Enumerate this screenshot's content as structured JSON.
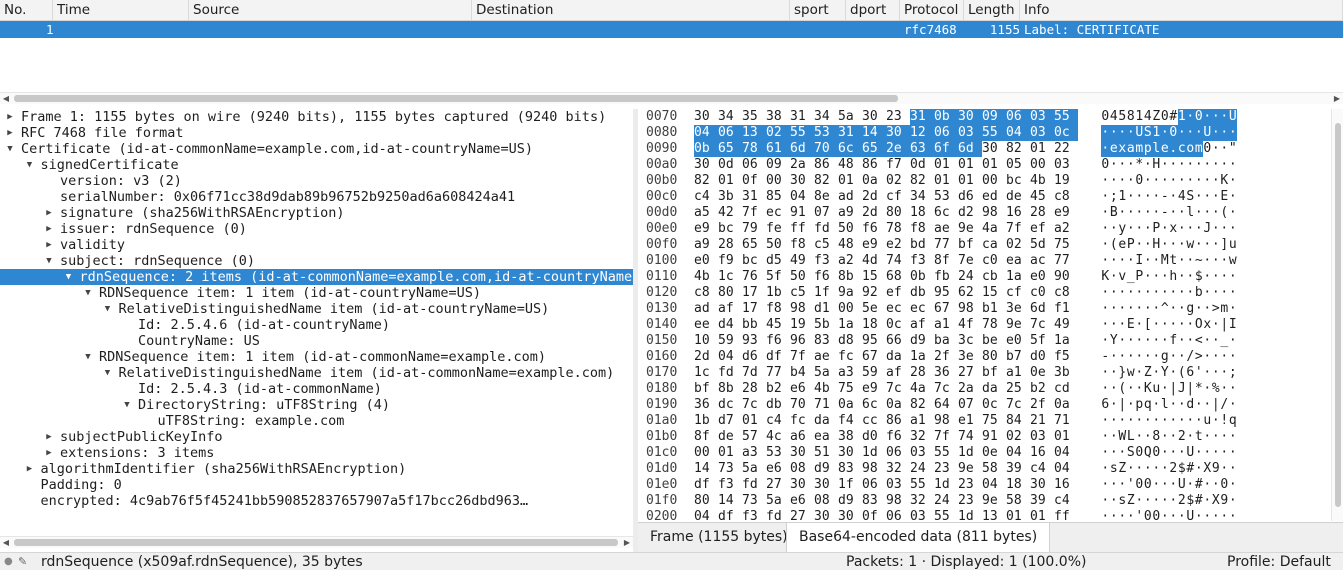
{
  "packet_list": {
    "columns": [
      "No.",
      "Time",
      "Source",
      "Destination",
      "sport",
      "dport",
      "Protocol",
      "Length",
      "Info"
    ],
    "rows": [
      {
        "no": "1",
        "time": "",
        "source": "",
        "destination": "",
        "sport": "",
        "dport": "",
        "protocol": "rfc7468",
        "length": "1155",
        "info": "Label: CERTIFICATE"
      }
    ]
  },
  "tree": [
    {
      "depth": 0,
      "arrow": "collapsed",
      "text": "Frame 1: 1155 bytes on wire (9240 bits), 1155 bytes captured (9240 bits)"
    },
    {
      "depth": 0,
      "arrow": "collapsed",
      "text": "RFC 7468 file format"
    },
    {
      "depth": 0,
      "arrow": "expanded",
      "text": "Certificate (id-at-commonName=example.com,id-at-countryName=US)"
    },
    {
      "depth": 1,
      "arrow": "expanded",
      "text": "signedCertificate"
    },
    {
      "depth": 2,
      "arrow": "none",
      "text": "version: v3 (2)"
    },
    {
      "depth": 2,
      "arrow": "none",
      "text": "serialNumber: 0x06f71cc38d9dab89b96752b9250ad6a608424a41"
    },
    {
      "depth": 2,
      "arrow": "collapsed",
      "text": "signature (sha256WithRSAEncryption)"
    },
    {
      "depth": 2,
      "arrow": "collapsed",
      "text": "issuer: rdnSequence (0)"
    },
    {
      "depth": 2,
      "arrow": "collapsed",
      "text": "validity"
    },
    {
      "depth": 2,
      "arrow": "expanded",
      "text": "subject: rdnSequence (0)"
    },
    {
      "depth": 3,
      "arrow": "expanded",
      "text": "rdnSequence: 2 items (id-at-commonName=example.com,id-at-countryName",
      "selected": true
    },
    {
      "depth": 4,
      "arrow": "expanded",
      "text": "RDNSequence item: 1 item (id-at-countryName=US)"
    },
    {
      "depth": 5,
      "arrow": "expanded",
      "text": "RelativeDistinguishedName item (id-at-countryName=US)"
    },
    {
      "depth": 6,
      "arrow": "none",
      "text": "Id: 2.5.4.6 (id-at-countryName)"
    },
    {
      "depth": 6,
      "arrow": "none",
      "text": "CountryName: US"
    },
    {
      "depth": 4,
      "arrow": "expanded",
      "text": "RDNSequence item: 1 item (id-at-commonName=example.com)"
    },
    {
      "depth": 5,
      "arrow": "expanded",
      "text": "RelativeDistinguishedName item (id-at-commonName=example.com)"
    },
    {
      "depth": 6,
      "arrow": "none",
      "text": "Id: 2.5.4.3 (id-at-commonName)"
    },
    {
      "depth": 6,
      "arrow": "expanded",
      "text": "DirectoryString: uTF8String (4)"
    },
    {
      "depth": 7,
      "arrow": "none",
      "text": "uTF8String: example.com"
    },
    {
      "depth": 2,
      "arrow": "collapsed",
      "text": "subjectPublicKeyInfo"
    },
    {
      "depth": 2,
      "arrow": "collapsed",
      "text": "extensions: 3 items"
    },
    {
      "depth": 1,
      "arrow": "collapsed",
      "text": "algorithmIdentifier (sha256WithRSAEncryption)"
    },
    {
      "depth": 1,
      "arrow": "none",
      "text": "Padding: 0"
    },
    {
      "depth": 1,
      "arrow": "none",
      "text": "encrypted: 4c9ab76f5f45241bb590852837657907a5f17bcc26dbd963…"
    }
  ],
  "hex": [
    {
      "off": "0070",
      "bytes": "30 34 35 38 31 34 5a 30 23 31 0b 30 09 06 03 55",
      "ascii": "045814Z0#1·0···U",
      "hl_start": 9,
      "hl_end": 16
    },
    {
      "off": "0080",
      "bytes": "04 06 13 02 55 53 31 14 30 12 06 03 55 04 03 0c",
      "ascii": "····US1·0···U···",
      "hl_start": 0,
      "hl_end": 16
    },
    {
      "off": "0090",
      "bytes": "0b 65 78 61 6d 70 6c 65 2e 63 6f 6d 30 82 01 22",
      "ascii": "·example.com0··\"",
      "hl_start": 0,
      "hl_end": 12
    },
    {
      "off": "00a0",
      "bytes": "30 0d 06 09 2a 86 48 86 f7 0d 01 01 01 05 00 03",
      "ascii": "0···*·H·········"
    },
    {
      "off": "00b0",
      "bytes": "82 01 0f 00 30 82 01 0a 02 82 01 01 00 bc 4b 19",
      "ascii": "····0·········K·"
    },
    {
      "off": "00c0",
      "bytes": "c4 3b 31 85 04 8e ad 2d cf 34 53 d6 ed de 45 c8",
      "ascii": "·;1····-·4S···E·"
    },
    {
      "off": "00d0",
      "bytes": "a5 42 7f ec 91 07 a9 2d 80 18 6c d2 98 16 28 e9",
      "ascii": "·B·····-··l···(·"
    },
    {
      "off": "00e0",
      "bytes": "e9 bc 79 fe ff fd 50 f6 78 f8 ae 9e 4a 7f ef a2",
      "ascii": "··y···P·x···J···"
    },
    {
      "off": "00f0",
      "bytes": "a9 28 65 50 f8 c5 48 e9 e2 bd 77 bf ca 02 5d 75",
      "ascii": "·(eP··H···w···]u"
    },
    {
      "off": "0100",
      "bytes": "e0 f9 bc d5 49 f3 a2 4d 74 f3 8f 7e c0 ea ac 77",
      "ascii": "····I··Mt··~···w"
    },
    {
      "off": "0110",
      "bytes": "4b 1c 76 5f 50 f6 8b 15 68 0b fb 24 cb 1a e0 90",
      "ascii": "K·v_P···h··$····"
    },
    {
      "off": "0120",
      "bytes": "c8 80 17 1b c5 1f 9a 92 ef db 95 62 15 cf c0 c8",
      "ascii": "···········b····"
    },
    {
      "off": "0130",
      "bytes": "ad af 17 f8 98 d1 00 5e ec ec 67 98 b1 3e 6d f1",
      "ascii": "·······^··g··>m·"
    },
    {
      "off": "0140",
      "bytes": "ee d4 bb 45 19 5b 1a 18 0c af a1 4f 78 9e 7c 49",
      "ascii": "···E·[·····Ox·|I"
    },
    {
      "off": "0150",
      "bytes": "10 59 93 f6 96 83 d8 95 66 d9 ba 3c be e0 5f 1a",
      "ascii": "·Y······f··<··_·"
    },
    {
      "off": "0160",
      "bytes": "2d 04 d6 df 7f ae fc 67 da 1a 2f 3e 80 b7 d0 f5",
      "ascii": "-······g··/>····"
    },
    {
      "off": "0170",
      "bytes": "1c fd 7d 77 b4 5a a3 59 af 28 36 27 bf a1 0e 3b",
      "ascii": "··}w·Z·Y·(6'···;"
    },
    {
      "off": "0180",
      "bytes": "bf 8b 28 b2 e6 4b 75 e9 7c 4a 7c 2a da 25 b2 cd",
      "ascii": "··(··Ku·|J|*·%··"
    },
    {
      "off": "0190",
      "bytes": "36 dc 7c db 70 71 0a 6c 0a 82 64 07 0c 7c 2f 0a",
      "ascii": "6·|·pq·l··d··|/·"
    },
    {
      "off": "01a0",
      "bytes": "1b d7 01 c4 fc da f4 cc 86 a1 98 e1 75 84 21 71",
      "ascii": "············u·!q"
    },
    {
      "off": "01b0",
      "bytes": "8f de 57 4c a6 ea 38 d0 f6 32 7f 74 91 02 03 01",
      "ascii": "··WL··8··2·t····"
    },
    {
      "off": "01c0",
      "bytes": "00 01 a3 53 30 51 30 1d 06 03 55 1d 0e 04 16 04",
      "ascii": "···S0Q0···U·····"
    },
    {
      "off": "01d0",
      "bytes": "14 73 5a e6 08 d9 83 98 32 24 23 9e 58 39 c4 04",
      "ascii": "·sZ·····2$#·X9··"
    },
    {
      "off": "01e0",
      "bytes": "df f3 fd 27 30 30 1f 06 03 55 1d 23 04 18 30 16",
      "ascii": "···'00···U·#··0·"
    },
    {
      "off": "01f0",
      "bytes": "80 14 73 5a e6 08 d9 83 98 32 24 23 9e 58 39 c4",
      "ascii": "··sZ·····2$#·X9·"
    },
    {
      "off": "0200",
      "bytes": "04 df f3 fd 27 30 30 0f 06 03 55 1d 13 01 01 ff",
      "ascii": "····'00···U·····"
    }
  ],
  "byte_tabs": [
    {
      "label": "Frame (1155 bytes)",
      "active": false
    },
    {
      "label": "Base64-encoded data (811 bytes)",
      "active": true
    }
  ],
  "status": {
    "field": "rdnSequence (x509af.rdnSequence), 35 bytes",
    "packets": "Packets: 1 · Displayed: 1 (100.0%)",
    "profile": "Profile: Default"
  },
  "colors": {
    "selection": "#2f87d1"
  }
}
